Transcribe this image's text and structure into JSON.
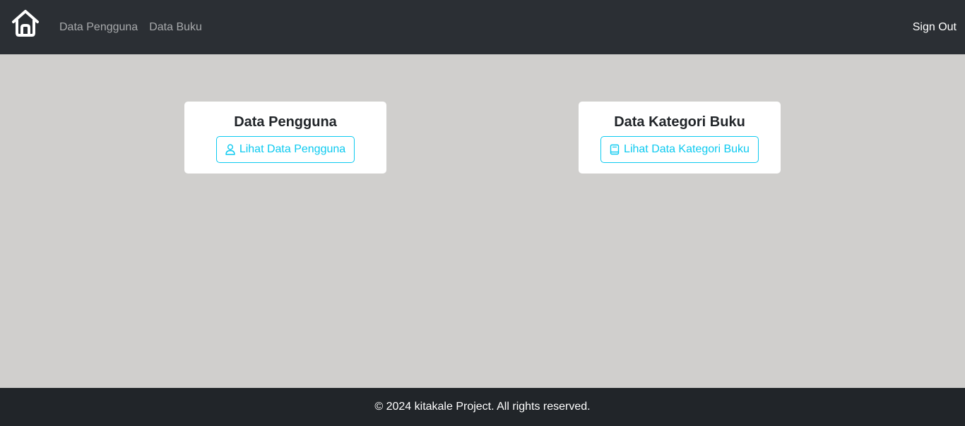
{
  "navbar": {
    "home_icon": "home-icon",
    "links": [
      {
        "label": "Data Pengguna"
      },
      {
        "label": "Data Buku"
      }
    ],
    "signout_label": "Sign Out"
  },
  "cards": [
    {
      "title": "Data Pengguna",
      "button_label": "Lihat Data Pengguna",
      "icon": "person-icon"
    },
    {
      "title": "Data Kategori Buku",
      "button_label": "Lihat Data Kategori Buku",
      "icon": "book-icon"
    }
  ],
  "footer": {
    "text": "© 2024 kitakale Project. All rights reserved."
  },
  "colors": {
    "navbar_bg": "#2b2f34",
    "page_bg": "#d0cfcd",
    "accent": "#0dcaf0",
    "footer_bg": "#212529"
  }
}
